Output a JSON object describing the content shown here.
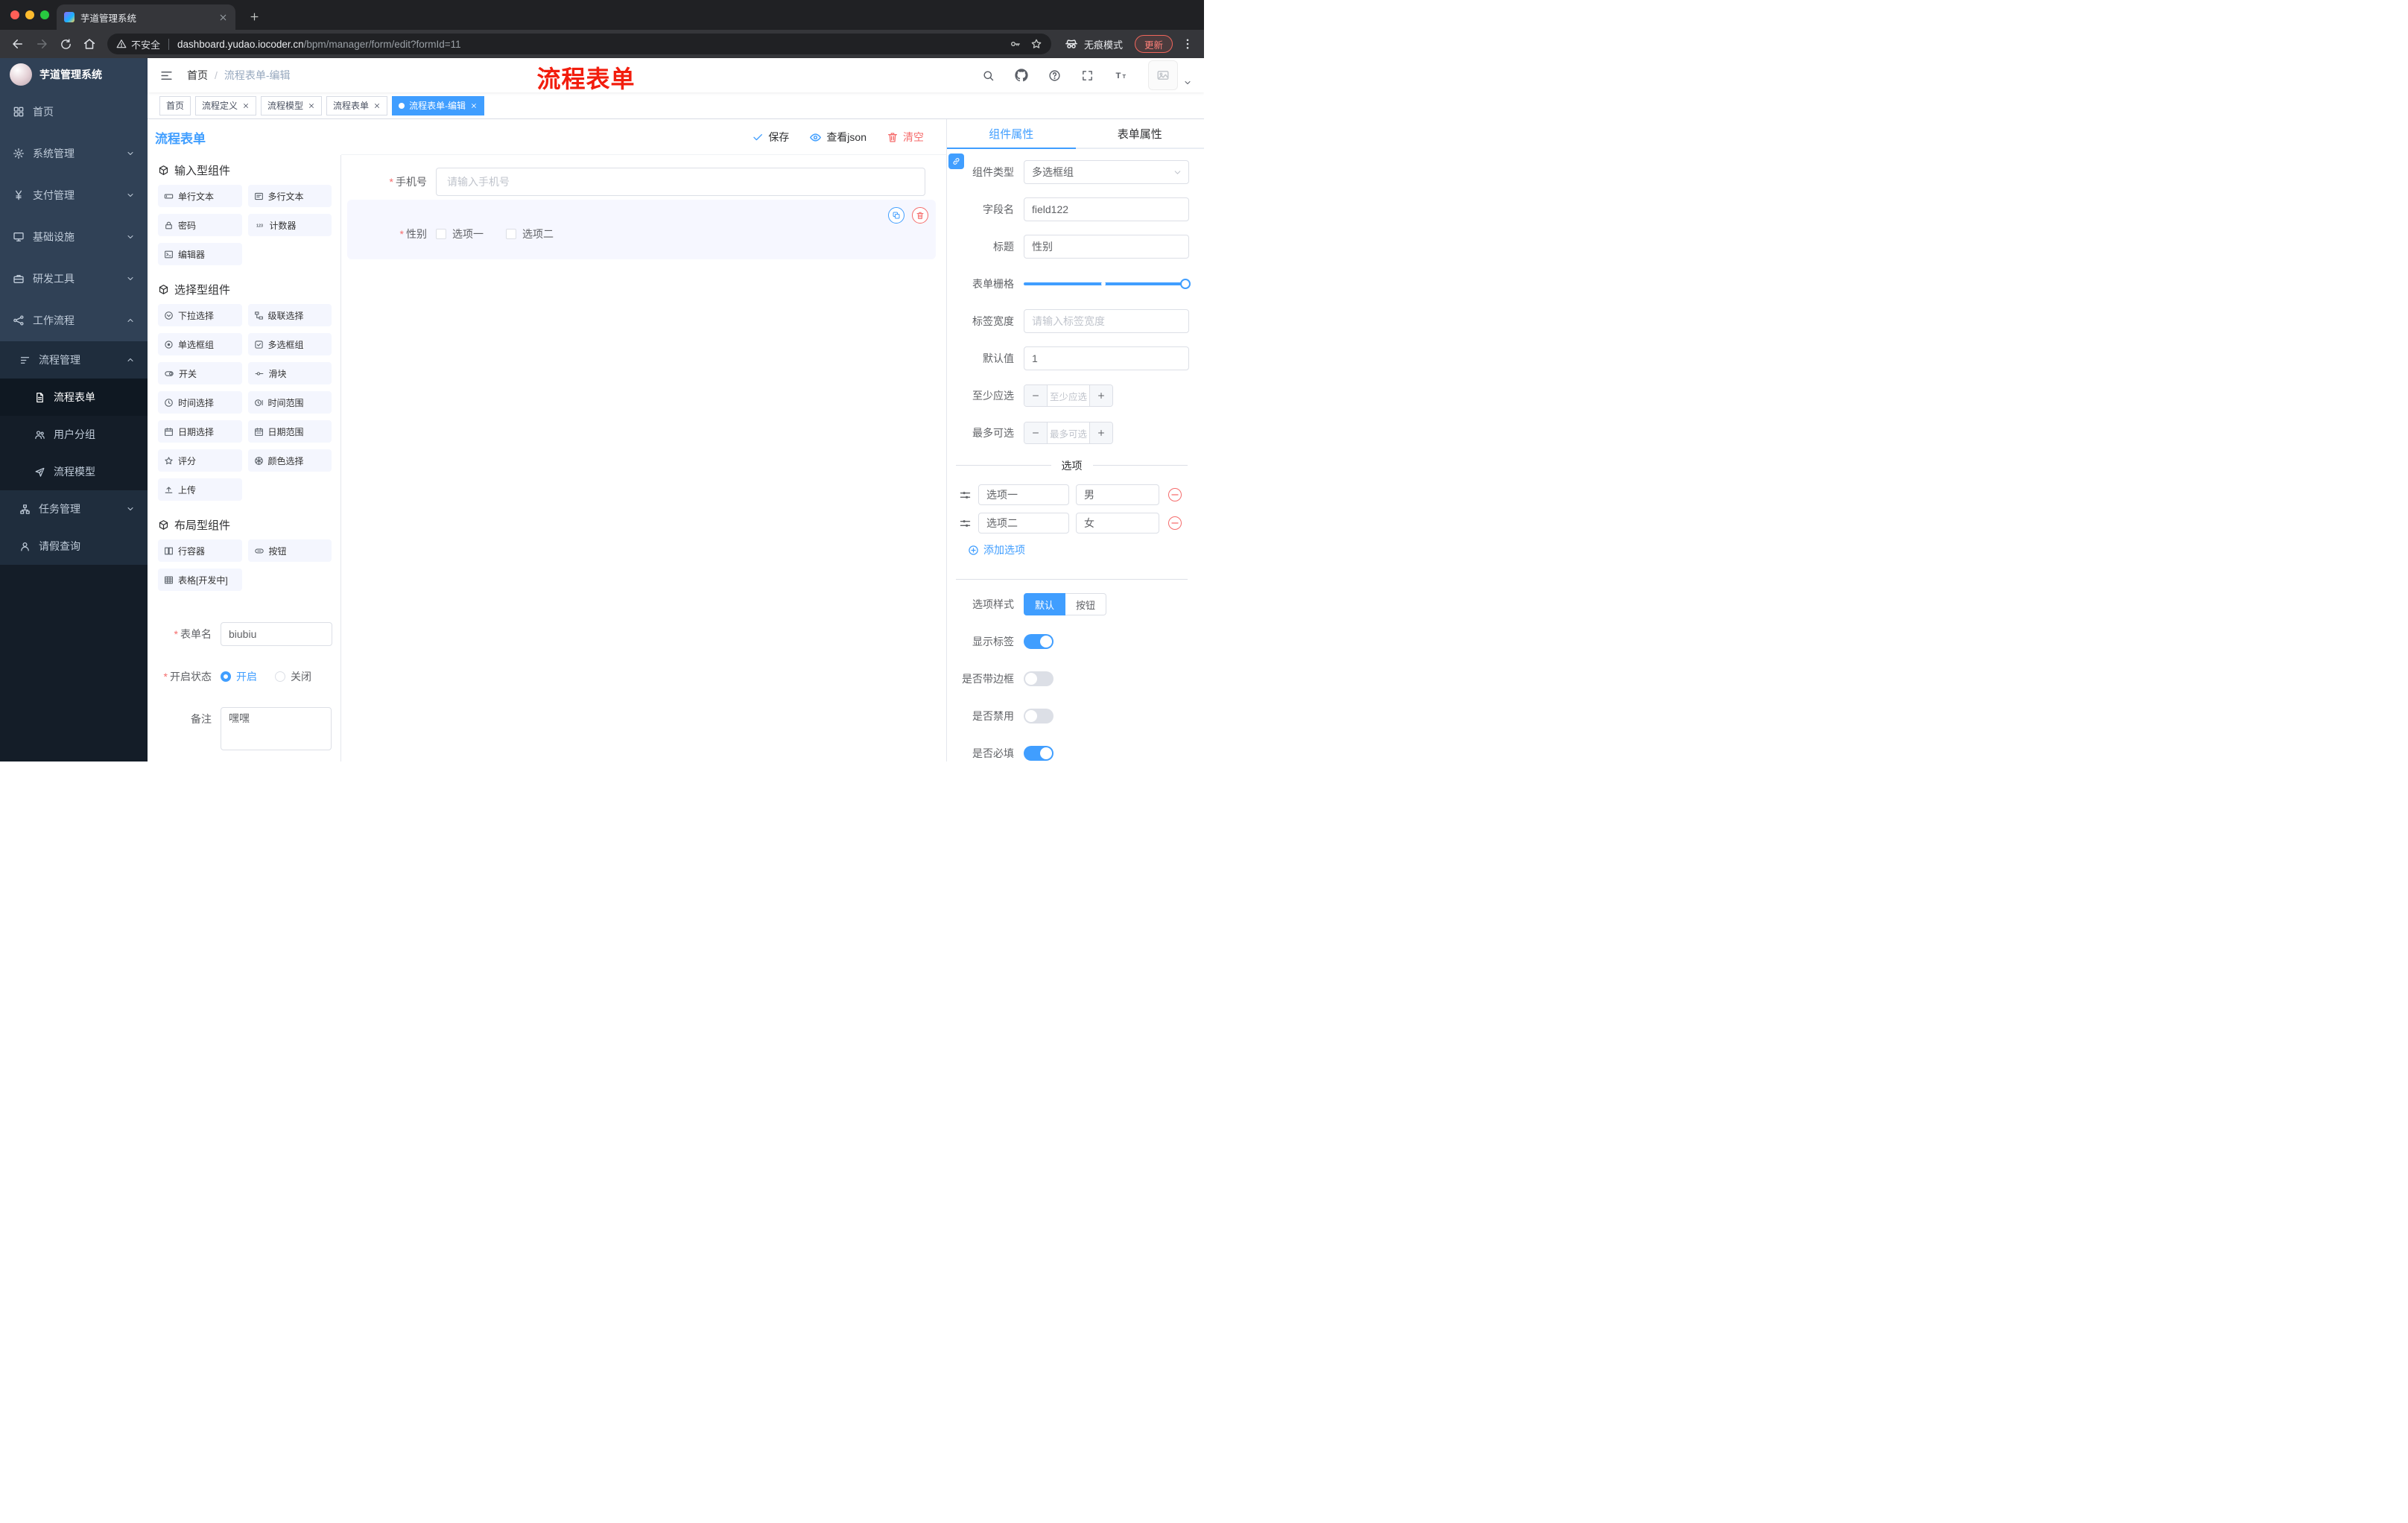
{
  "browser": {
    "tab_title": "芋道管理系统",
    "security_label": "不安全",
    "url_domain": "dashboard.yudao.iocoder.cn",
    "url_path": "/bpm/manager/form/edit?formId=11",
    "incognito_label": "无痕模式",
    "update_label": "更新"
  },
  "sidebar": {
    "logo_title": "芋道管理系统",
    "menu": [
      {
        "label": "首页"
      },
      {
        "label": "系统管理"
      },
      {
        "label": "支付管理"
      },
      {
        "label": "基础设施"
      },
      {
        "label": "研发工具"
      },
      {
        "label": "工作流程"
      }
    ],
    "submenu_group": "流程管理",
    "submenu_children": [
      {
        "label": "流程表单"
      },
      {
        "label": "用户分组"
      },
      {
        "label": "流程模型"
      }
    ],
    "submenu_siblings": [
      {
        "label": "任务管理"
      },
      {
        "label": "请假查询"
      }
    ]
  },
  "header": {
    "breadcrumb_home": "首页",
    "breadcrumb_sep": "/",
    "breadcrumb_current": "流程表单-编辑",
    "annotation": "流程表单"
  },
  "tags": [
    {
      "label": "首页"
    },
    {
      "label": "流程定义"
    },
    {
      "label": "流程模型"
    },
    {
      "label": "流程表单"
    },
    {
      "label": "流程表单-编辑"
    }
  ],
  "designer": {
    "title": "流程表单",
    "save_label": "保存",
    "view_json_label": "查看json",
    "clear_label": "清空"
  },
  "palette": {
    "sections": [
      {
        "title": "输入型组件",
        "items": [
          {
            "label": "单行文本"
          },
          {
            "label": "多行文本"
          },
          {
            "label": "密码"
          },
          {
            "label": "计数器"
          },
          {
            "label": "编辑器"
          }
        ]
      },
      {
        "title": "选择型组件",
        "items": [
          {
            "label": "下拉选择"
          },
          {
            "label": "级联选择"
          },
          {
            "label": "单选框组"
          },
          {
            "label": "多选框组"
          },
          {
            "label": "开关"
          },
          {
            "label": "滑块"
          },
          {
            "label": "时间选择"
          },
          {
            "label": "时间范围"
          },
          {
            "label": "日期选择"
          },
          {
            "label": "日期范围"
          },
          {
            "label": "评分"
          },
          {
            "label": "颜色选择"
          },
          {
            "label": "上传"
          }
        ]
      },
      {
        "title": "布局型组件",
        "items": [
          {
            "label": "行容器"
          },
          {
            "label": "按钮"
          },
          {
            "label": "表格[开发中]"
          }
        ]
      }
    ],
    "meta": {
      "form_name_label": "表单名",
      "form_name_value": "biubiu",
      "status_label": "开启状态",
      "status_on": "开启",
      "status_off": "关闭",
      "remark_label": "备注",
      "remark_value": "嘿嘿"
    }
  },
  "canvas": {
    "phone": {
      "label": "手机号",
      "placeholder": "请输入手机号"
    },
    "gender": {
      "label": "性别",
      "option1": "选项一",
      "option2": "选项二"
    }
  },
  "props": {
    "tab_component": "组件属性",
    "tab_form": "表单属性",
    "component_type_label": "组件类型",
    "component_type_value": "多选框组",
    "field_name_label": "字段名",
    "field_name_value": "field122",
    "title_label": "标题",
    "title_value": "性别",
    "grid_label": "表单栅格",
    "label_width_label": "标签宽度",
    "label_width_placeholder": "请输入标签宽度",
    "default_label": "默认值",
    "default_value": "1",
    "min_label": "至少应选",
    "min_placeholder": "至少应选",
    "max_label": "最多可选",
    "max_placeholder": "最多可选",
    "options_title": "选项",
    "options": [
      {
        "name": "选项一",
        "value": "男"
      },
      {
        "name": "选项二",
        "value": "女"
      }
    ],
    "add_option_label": "添加选项",
    "style_label": "选项样式",
    "style_default": "默认",
    "style_button": "按钮",
    "switch_show_label": "显示标签",
    "switch_border_label": "是否带边框",
    "switch_disabled_label": "是否禁用",
    "switch_required_label": "是否必填"
  },
  "colors": {
    "accent": "#409eff",
    "danger": "#f56c6c",
    "annotation_red": "#f21d0d",
    "sidebar_bg": "#304156"
  }
}
